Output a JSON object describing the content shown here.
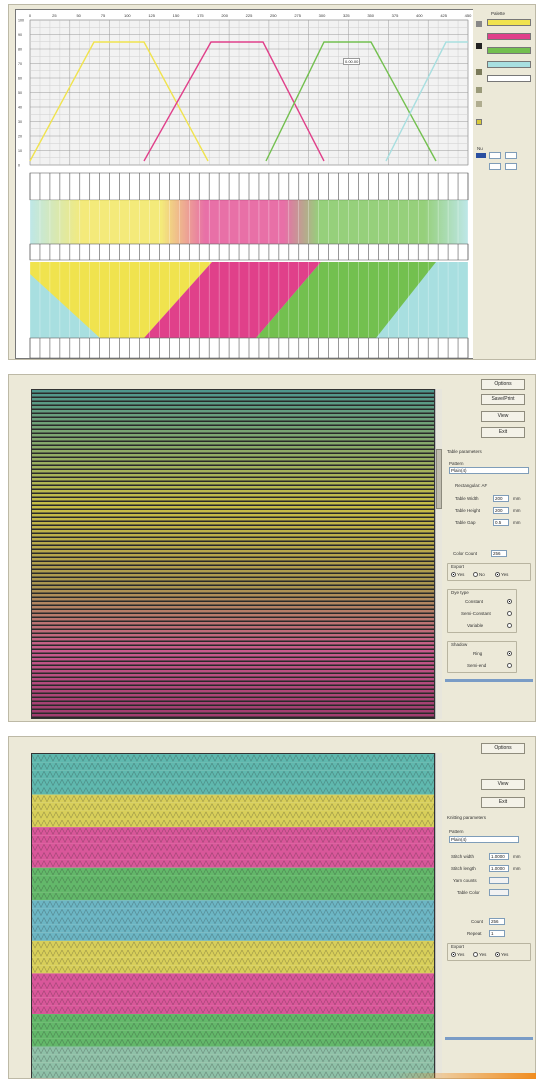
{
  "colors": {
    "yellow": "#f0e34e",
    "pink": "#e0408a",
    "green": "#73c04f",
    "cyan": "#a8dfe0",
    "gray_bg": "#ece9d8"
  },
  "editor": {
    "x_ticks": [
      "0",
      "25",
      "50",
      "75",
      "100",
      "125",
      "150",
      "175",
      "200",
      "225",
      "250",
      "275",
      "300",
      "325",
      "350",
      "375",
      "400",
      "425",
      "450"
    ],
    "y_ticks": [
      "100",
      "90",
      "80",
      "70",
      "60",
      "50",
      "40",
      "30",
      "20",
      "10",
      "0"
    ],
    "annotation": "0.00.00",
    "palette_title": "Palette",
    "bottom_label": "Nu"
  },
  "weave": {
    "buttons": [
      "Options",
      "Save/Print",
      "View",
      "Exit"
    ],
    "section_title": "Table parameters",
    "pattern_label": "Pattern",
    "pattern_value": "Plain(4)",
    "rect_label": "Rectangular: AF",
    "fields": [
      {
        "label": "Table Width",
        "value": "200",
        "unit": "mm"
      },
      {
        "label": "Table Height",
        "value": "200",
        "unit": "mm"
      },
      {
        "label": "Table Gap",
        "value": "0.5",
        "unit": "mm"
      }
    ],
    "count_label": "Color Count",
    "count_value": "256",
    "export_title": "Export",
    "export_options": [
      "Yes",
      "No",
      "Yes"
    ],
    "group_title": "Dye type",
    "group_options": [
      "Constant",
      "Semi-Constant",
      "Variable"
    ],
    "shadow_title": "Shadow",
    "shadow_options": [
      "Ring",
      "Semi-end"
    ]
  },
  "knit": {
    "buttons": [
      "Options",
      "View",
      "Exit"
    ],
    "section_title": "Knitting parameters",
    "pattern_label": "Pattern",
    "pattern_value": "Plain(4)",
    "fields": [
      {
        "label": "Stitch width",
        "value": "1.0000",
        "unit": "mm"
      },
      {
        "label": "Stitch length",
        "value": "1.0000",
        "unit": "mm"
      },
      {
        "label": "Yarn counts",
        "value": "",
        "unit": ""
      },
      {
        "label": "Table Color",
        "value": "",
        "unit": ""
      }
    ],
    "count_label": "Count",
    "count_value": "256",
    "repeat_label": "Repeat",
    "repeat_value": "1",
    "export_title": "Export",
    "export_options": [
      "Yes",
      "Yes",
      "Yes"
    ]
  }
}
